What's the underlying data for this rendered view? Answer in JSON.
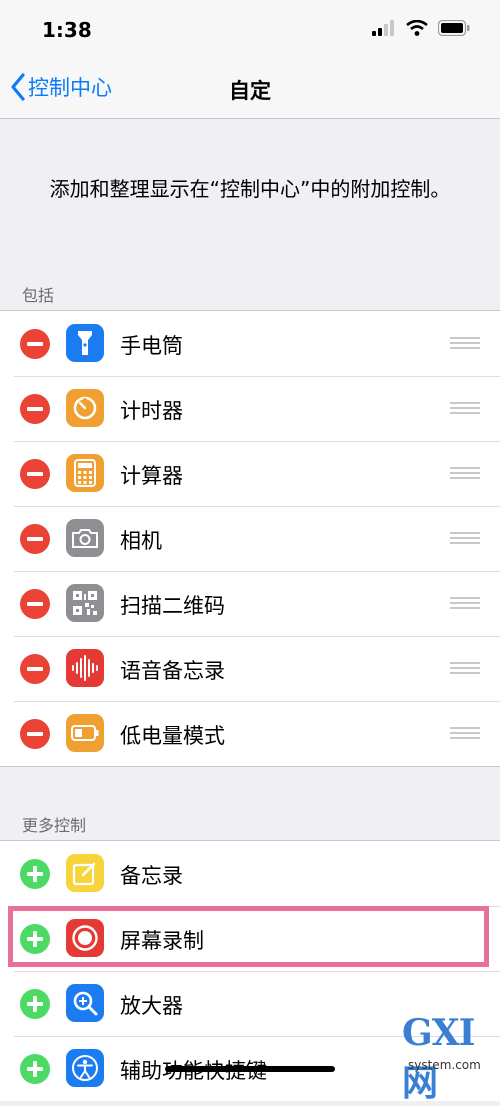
{
  "status_bar": {
    "time": "1:38"
  },
  "nav": {
    "back_label": "控制中心",
    "title": "自定"
  },
  "description": "添加和整理显示在“控制中心”中的附加控制。",
  "included": {
    "header": "包括",
    "items": [
      {
        "label": "手电筒",
        "icon": "flashlight-icon",
        "color": "#1b7cf2"
      },
      {
        "label": "计时器",
        "icon": "timer-icon",
        "color": "#f0a030"
      },
      {
        "label": "计算器",
        "icon": "calculator-icon",
        "color": "#f0a030"
      },
      {
        "label": "相机",
        "icon": "camera-icon",
        "color": "#8e8e93"
      },
      {
        "label": "扫描二维码",
        "icon": "qr-code-icon",
        "color": "#8e8e93"
      },
      {
        "label": "语音备忘录",
        "icon": "voice-memo-icon",
        "color": "#e53935"
      },
      {
        "label": "低电量模式",
        "icon": "low-power-icon",
        "color": "#f0a030"
      }
    ]
  },
  "more": {
    "header": "更多控制",
    "items": [
      {
        "label": "备忘录",
        "icon": "notes-icon",
        "color": "#f7d33c"
      },
      {
        "label": "屏幕录制",
        "icon": "screen-record-icon",
        "color": "#e53935"
      },
      {
        "label": "放大器",
        "icon": "magnifier-icon",
        "color": "#1b7cf2"
      },
      {
        "label": "辅助功能快捷键",
        "icon": "accessibility-icon",
        "color": "#1b7cf2"
      }
    ]
  },
  "watermark": {
    "logo": "GXI网",
    "url": "system.com"
  }
}
